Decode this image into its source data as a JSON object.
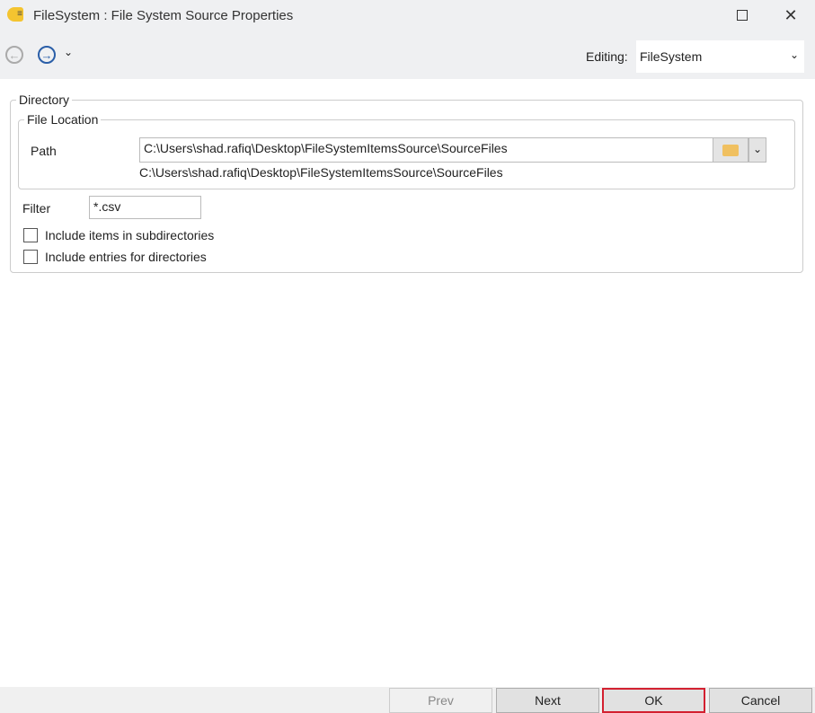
{
  "window": {
    "title": "FileSystem : File System Source Properties"
  },
  "toolbar": {
    "editing_label": "Editing:",
    "editing_value": "FileSystem"
  },
  "directory": {
    "legend": "Directory",
    "file_location": {
      "legend": "File Location",
      "path_label": "Path",
      "path_value": "C:\\Users\\shad.rafiq\\Desktop\\FileSystemItemsSource\\SourceFiles",
      "path_resolved": "C:\\Users\\shad.rafiq\\Desktop\\FileSystemItemsSource\\SourceFiles"
    },
    "filter_label": "Filter",
    "filter_value": "*.csv",
    "include_subdirs": {
      "label": "Include items in subdirectories",
      "checked": false
    },
    "include_dirs": {
      "label": "Include entries for directories",
      "checked": false
    }
  },
  "buttons": {
    "prev": "Prev",
    "next": "Next",
    "ok": "OK",
    "cancel": "Cancel"
  }
}
